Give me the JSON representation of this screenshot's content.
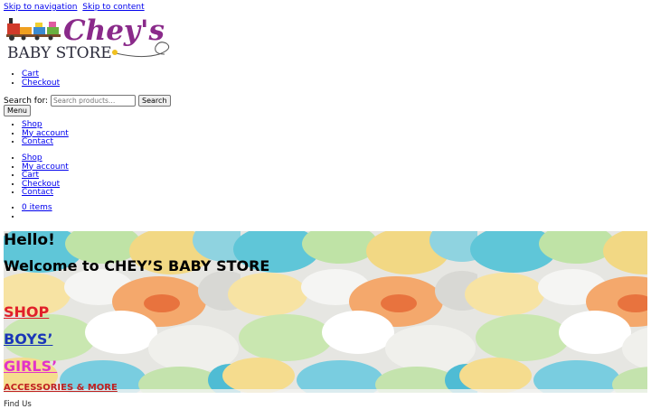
{
  "skip": {
    "navigation": "Skip to navigation",
    "content": "Skip to content"
  },
  "logo": {
    "line1": "Chey's",
    "line2": "BABY STORE"
  },
  "header_links": [
    {
      "label": "Cart"
    },
    {
      "label": "Checkout"
    }
  ],
  "search": {
    "label": "Search for:",
    "placeholder": "Search products…",
    "button": "Search"
  },
  "menu_button": "Menu",
  "primary_menu": [
    {
      "label": "Shop"
    },
    {
      "label": "My account"
    },
    {
      "label": "Contact"
    }
  ],
  "handheld_menu": [
    {
      "label": "Shop"
    },
    {
      "label": "My account"
    },
    {
      "label": "Cart"
    },
    {
      "label": "Checkout"
    },
    {
      "label": "Contact"
    }
  ],
  "cart": {
    "items_label": "0 items"
  },
  "hero": {
    "hello": "Hello!",
    "welcome": "Welcome to CHEY’S BABY STORE",
    "shop": "SHOP",
    "boys": "BOYS’",
    "girls": "GIRLS’",
    "accessories": "ACCESSORIES & MORE"
  },
  "footer": {
    "find_us": "Find Us"
  },
  "colors": {
    "link": "#0000ee",
    "shop": "#e0202a",
    "boys": "#1a36b8",
    "girls": "#e233c8",
    "accessories": "#c02020"
  }
}
